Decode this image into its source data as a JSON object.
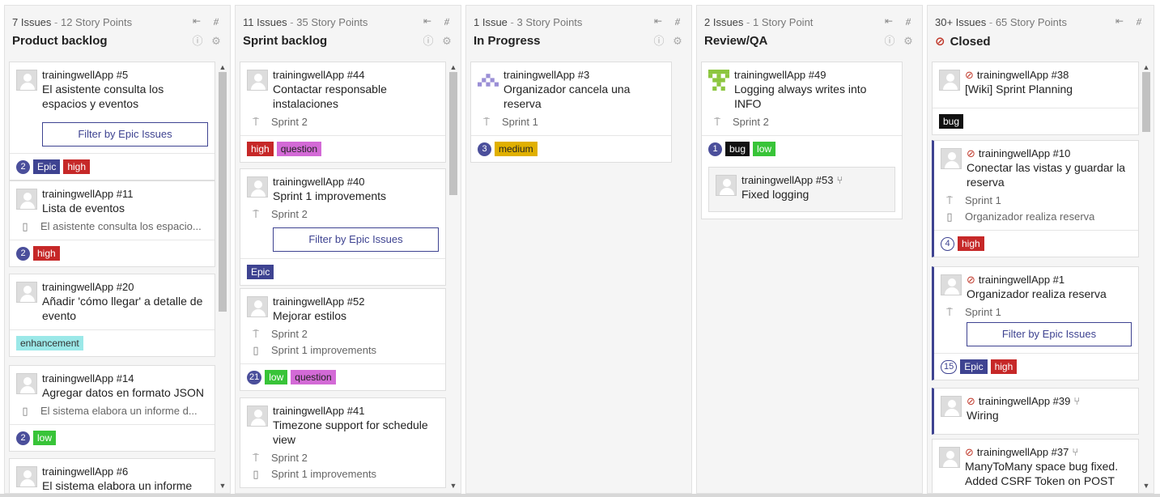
{
  "icons": {
    "expand": "collapse-left-icon",
    "wrap": "wrap-icon",
    "info": "info-icon",
    "settings": "gear-icon"
  },
  "colors": {
    "epic": "#3e4391",
    "high": "#c62828",
    "question": "#d36ad6",
    "low": "#38c438",
    "bug": "#111111",
    "medium": "#e0b000",
    "enhancement": "#9be8e8"
  },
  "columns": [
    {
      "issues": "7 Issues",
      "sep": " - ",
      "points": "12 Story Points",
      "title": "Product backlog"
    },
    {
      "issues": "11 Issues",
      "sep": " - ",
      "points": "35 Story Points",
      "title": "Sprint backlog"
    },
    {
      "issues": "1 Issue",
      "sep": " - ",
      "points": "3 Story Points",
      "title": "In Progress"
    },
    {
      "issues": "2 Issues",
      "sep": " - ",
      "points": "1 Story Point",
      "title": "Review/QA"
    },
    {
      "issues": "30+ Issues",
      "sep": " - ",
      "points": "65 Story Points",
      "title": "Closed"
    }
  ],
  "cards": {
    "c5": {
      "key": "trainingwellApp #5",
      "summary": "El asistente consulta los espacios y eventos",
      "filter": "Filter by Epic Issues",
      "points": "2",
      "labels": [
        "Epic",
        "high"
      ]
    },
    "c11": {
      "key": "trainingwellApp #11",
      "summary": "Lista de eventos",
      "epic": "El asistente consulta los espacio...",
      "points": "2",
      "labels": [
        "high"
      ]
    },
    "c20": {
      "key": "trainingwellApp #20",
      "summary": "Añadir 'cómo llegar' a detalle de evento",
      "labels": [
        "enhancement"
      ]
    },
    "c14": {
      "key": "trainingwellApp #14",
      "summary": "Agregar datos en formato JSON",
      "epic": "El sistema elabora un informe d...",
      "points": "2",
      "labels": [
        "low"
      ]
    },
    "c6": {
      "key": "trainingwellApp #6",
      "summary": "El sistema elabora un informe"
    },
    "c44": {
      "key": "trainingwellApp #44",
      "summary": "Contactar responsable instalaciones",
      "sprint": "Sprint 2",
      "labels": [
        "high",
        "question"
      ]
    },
    "c40": {
      "key": "trainingwellApp #40",
      "summary": "Sprint 1 improvements",
      "sprint": "Sprint 2",
      "filter": "Filter by Epic Issues",
      "labels": [
        "Epic"
      ]
    },
    "c52": {
      "key": "trainingwellApp #52",
      "summary": "Mejorar estilos",
      "sprint": "Sprint 2",
      "epic": "Sprint 1 improvements",
      "points": "21",
      "labels": [
        "low",
        "question"
      ]
    },
    "c41": {
      "key": "trainingwellApp #41",
      "summary": "Timezone support for schedule view",
      "sprint": "Sprint 2",
      "epic": "Sprint 1 improvements"
    },
    "c3": {
      "key": "trainingwellApp #3",
      "summary": "Organizador cancela una reserva",
      "sprint": "Sprint 1",
      "points": "3",
      "labels": [
        "medium"
      ]
    },
    "c49": {
      "key": "trainingwellApp #49",
      "summary": "Logging always writes into INFO",
      "sprint": "Sprint 2",
      "points": "1",
      "labels": [
        "bug",
        "low"
      ]
    },
    "c53": {
      "key": "trainingwellApp #53",
      "summary": "Fixed logging"
    },
    "c38": {
      "key": "trainingwellApp #38",
      "summary": "[Wiki] Sprint Planning",
      "labels": [
        "bug"
      ]
    },
    "c10": {
      "key": "trainingwellApp #10",
      "summary": "Conectar las vistas y guardar la reserva",
      "sprint": "Sprint 1",
      "epic": "Organizador realiza reserva",
      "points": "4",
      "labels": [
        "high"
      ]
    },
    "c1": {
      "key": "trainingwellApp #1",
      "summary": "Organizador realiza reserva",
      "sprint": "Sprint 1",
      "filter": "Filter by Epic Issues",
      "points": "15",
      "labels": [
        "Epic",
        "high"
      ]
    },
    "c39": {
      "key": "trainingwellApp #39",
      "summary": "Wiring"
    },
    "c37": {
      "key": "trainingwellApp #37",
      "summary": "ManyToMany space bug fixed. Added CSRF Token on POST"
    }
  },
  "scroll": {
    "up": "▲",
    "down": "▼"
  }
}
